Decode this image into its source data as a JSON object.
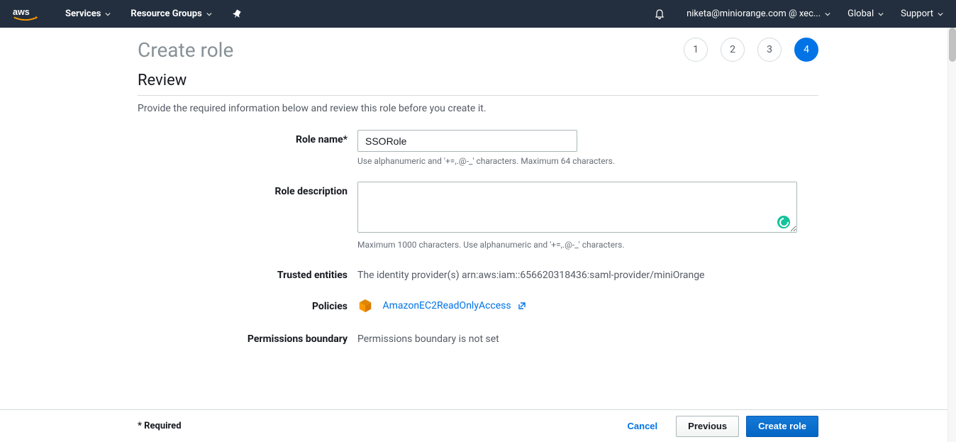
{
  "nav": {
    "services": "Services",
    "resource_groups": "Resource Groups",
    "account": "niketa@miniorange.com @ xec...",
    "region": "Global",
    "support": "Support"
  },
  "page": {
    "title": "Create role",
    "steps": [
      "1",
      "2",
      "3",
      "4"
    ],
    "active_step": 4,
    "section_title": "Review",
    "section_desc": "Provide the required information below and review this role before you create it."
  },
  "form": {
    "role_name": {
      "label": "Role name*",
      "value": "SSORole",
      "hint": "Use alphanumeric and '+=,.@-_' characters. Maximum 64 characters."
    },
    "role_description": {
      "label": "Role description",
      "value": "",
      "hint": "Maximum 1000 characters. Use alphanumeric and '+=,.@-_' characters."
    },
    "trusted_entities": {
      "label": "Trusted entities",
      "value": "The identity provider(s) arn:aws:iam::656620318436:saml-provider/miniOrange"
    },
    "policies": {
      "label": "Policies",
      "policy_name": "AmazonEC2ReadOnlyAccess"
    },
    "permissions_boundary": {
      "label": "Permissions boundary",
      "value": "Permissions boundary is not set"
    }
  },
  "footer": {
    "required_note": "* Required",
    "cancel": "Cancel",
    "previous": "Previous",
    "create": "Create role"
  }
}
